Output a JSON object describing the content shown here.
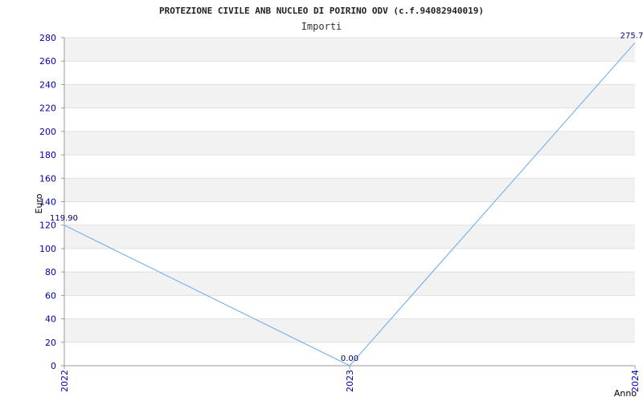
{
  "chart_data": {
    "type": "line",
    "title": "PROTEZIONE CIVILE ANB NUCLEO DI POIRINO ODV (c.f.94082940019)",
    "subtitle": "Importi",
    "xlabel": "Anno",
    "ylabel": "Euro",
    "x": [
      "2022",
      "2023",
      "2024"
    ],
    "series": [
      {
        "values": [
          119.9,
          0.0,
          275.7
        ],
        "labels": [
          "119.90",
          "0.00",
          "275.7"
        ]
      }
    ],
    "ylim": [
      0,
      280
    ],
    "yticks": [
      0,
      20,
      40,
      60,
      80,
      100,
      120,
      140,
      160,
      180,
      200,
      220,
      240,
      260,
      280
    ],
    "grid": true,
    "colors": {
      "line": "#66aaee",
      "band": "#f2f2f2",
      "tick_text": "#0000aa"
    }
  }
}
